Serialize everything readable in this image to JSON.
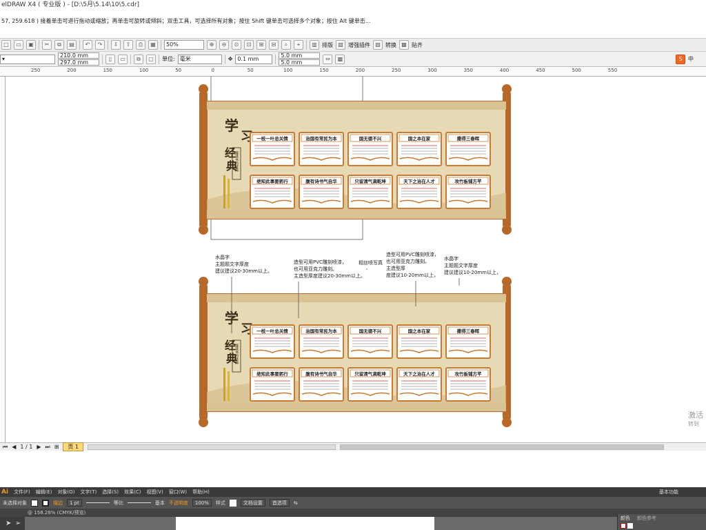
{
  "window": {
    "title": "elDRAW X4 ( 专业版 ) - [D:\\5月\\5.14\\10\\5.cdr]"
  },
  "status": {
    "text": "57, 259.618 )   接着单击可进行拖动或缩放；再单击可旋转或倾斜；双击工具，可选择所有对象；按住 Shift 键单击可选择多个对象；按住 Alt 键单击..."
  },
  "toolbar": {
    "zoom": "50%",
    "menus": [
      "排版",
      "增强插件",
      "转换",
      "贴齐"
    ]
  },
  "property_bar": {
    "width": "210.0 mm",
    "height": "297.0 mm",
    "unit_label": "单位:",
    "unit_value": "毫米",
    "nudge": "0.1 mm",
    "dup_x": "5.0 mm",
    "dup_y": "5.0 mm"
  },
  "ruler": {
    "ticks": [
      "250",
      "200",
      "150",
      "100",
      "50",
      "0",
      "50",
      "100",
      "150",
      "200",
      "250",
      "300",
      "350",
      "400",
      "450",
      "500",
      "550"
    ]
  },
  "design": {
    "title_chars": [
      "学",
      "习",
      "经",
      "典"
    ],
    "title_tag": "展读书的经典",
    "books_row1": [
      "一枝一叶总关情",
      "治国有常民为本",
      "国无德不兴",
      "国之本在家",
      "撒得三春晖"
    ],
    "books_row2": [
      "绝知此事要躬行",
      "腹有诗书气自华",
      "只留清气满乾坤",
      "天下之治在人才",
      "攻竹板铺方芊"
    ]
  },
  "annotations": [
    {
      "lines": [
        "水晶字",
        "主题题文字厚度",
        "建议建议20-30mm以上。"
      ]
    },
    {
      "lines": [
        "造型可用PVC雕刻喷漆，",
        "也可用亚克力雕刻。",
        "主造型厚度建议20-30mm以上。"
      ]
    },
    {
      "lines": [
        "相丝喷写真"
      ]
    },
    {
      "lines": [
        "造型可用PVC雕刻喷漆，",
        "也可用亚克力雕刻。",
        "主造型厚",
        "度建议10-20mm以上，"
      ]
    },
    {
      "lines": [
        "水晶字",
        "主题题文字厚度",
        "建议建议10-20mm以上，"
      ]
    }
  ],
  "pagebar": {
    "page_count": "1 / 1",
    "page_tab": "页 1"
  },
  "illustrator": {
    "menu": [
      "文件(F)",
      "编辑(E)",
      "对象(O)",
      "文字(T)",
      "选择(S)",
      "效果(C)",
      "视图(V)",
      "窗口(W)",
      "帮助(H)"
    ],
    "workspace": "基本功能",
    "ctrl_no_selection": "未选择对象",
    "ctrl_stroke": "描边",
    "ctrl_stroke_value": "1 pt",
    "ctrl_equal": "等比",
    "ctrl_basic": "基本",
    "ctrl_opacity_label": "不透明度",
    "ctrl_opacity": "100%",
    "ctrl_style": "样式",
    "ctrl_doc_setup": "文档设置",
    "ctrl_prefs": "首选项",
    "doc_tab": "@ 158.28% (CMYK/预览)",
    "panel_color": "颜色",
    "panel_color_ref": "颜色参考"
  },
  "activation": {
    "line1": "激活",
    "line2": "转到"
  },
  "colors": {
    "scroll_rod": "#b8692a",
    "board": "#e8d9b5",
    "book_border": "#c97a30",
    "title": "#3b2a18"
  }
}
